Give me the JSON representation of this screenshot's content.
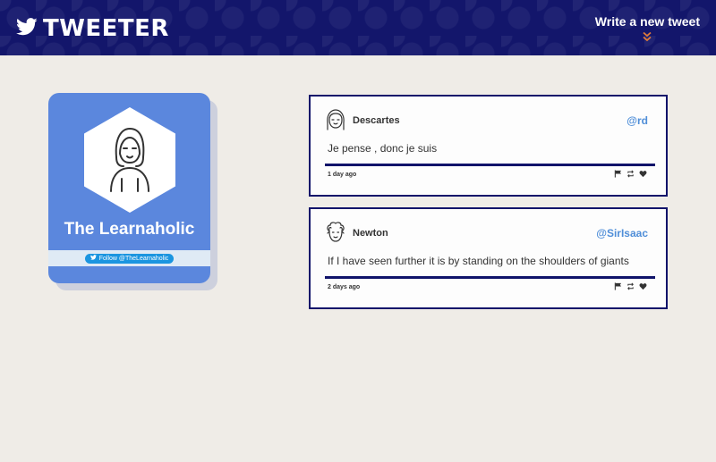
{
  "header": {
    "brand": "TWEETER",
    "brand_icon": "bird-icon",
    "write_link": "Write a new tweet",
    "write_icon": "double-chevron-down-icon",
    "bg_color": "#13166b",
    "accent_color": "#e07b39"
  },
  "profile": {
    "name": "The Learnaholic",
    "follow_label": "Follow @TheLearnaholic",
    "card_color": "#5b87dd"
  },
  "tweets": [
    {
      "author": "Descartes",
      "handle": "@rd",
      "content": "Je pense , donc je suis",
      "time": "1 day ago"
    },
    {
      "author": "Newton",
      "handle": "@SirIsaac",
      "content": "If I have seen further it is by standing on the shoulders of giants",
      "time": "2 days ago"
    }
  ],
  "colors": {
    "page_bg": "#efece7",
    "tweet_border": "#10136a",
    "handle": "#4f8ed8"
  }
}
